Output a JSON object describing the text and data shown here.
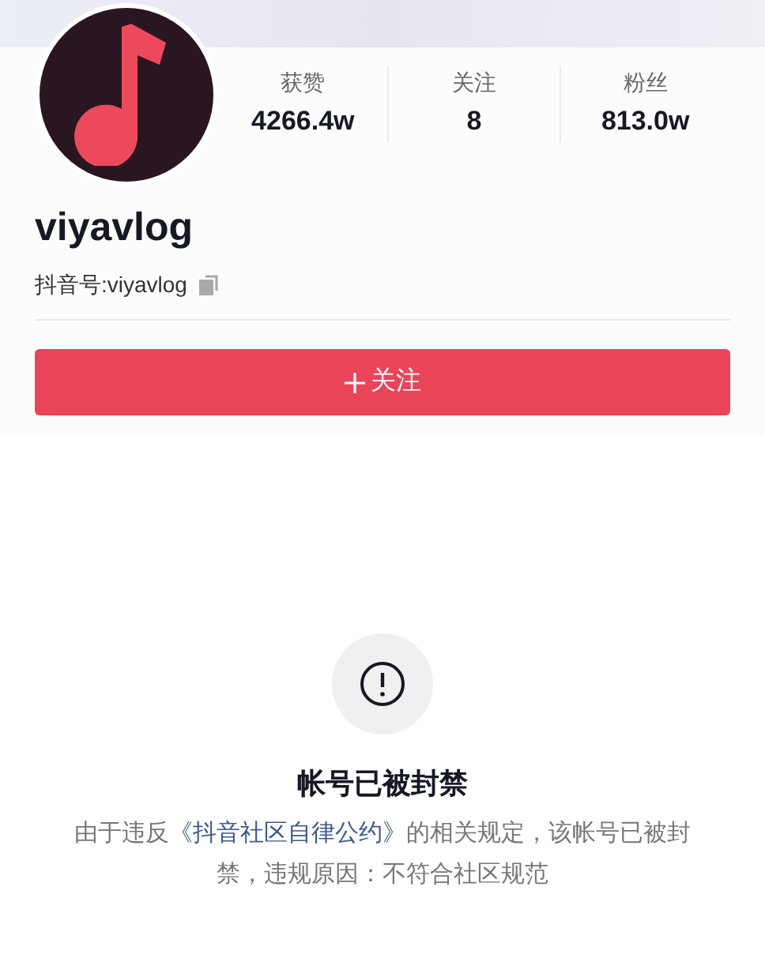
{
  "profile": {
    "name": "viyavlog",
    "id_label": "抖音号:",
    "id_value": "viyavlog"
  },
  "stats": [
    {
      "label": "获赞",
      "value": "4266.4w"
    },
    {
      "label": "关注",
      "value": "8"
    },
    {
      "label": "粉丝",
      "value": "813.0w"
    }
  ],
  "follow_button": {
    "label": "关注"
  },
  "banned": {
    "title": "帐号已被封禁",
    "text_before": "由于违反",
    "link": "《抖音社区自律公约》",
    "text_after": "的相关规定，该帐号已被封禁，违规原因：不符合社区规范"
  }
}
